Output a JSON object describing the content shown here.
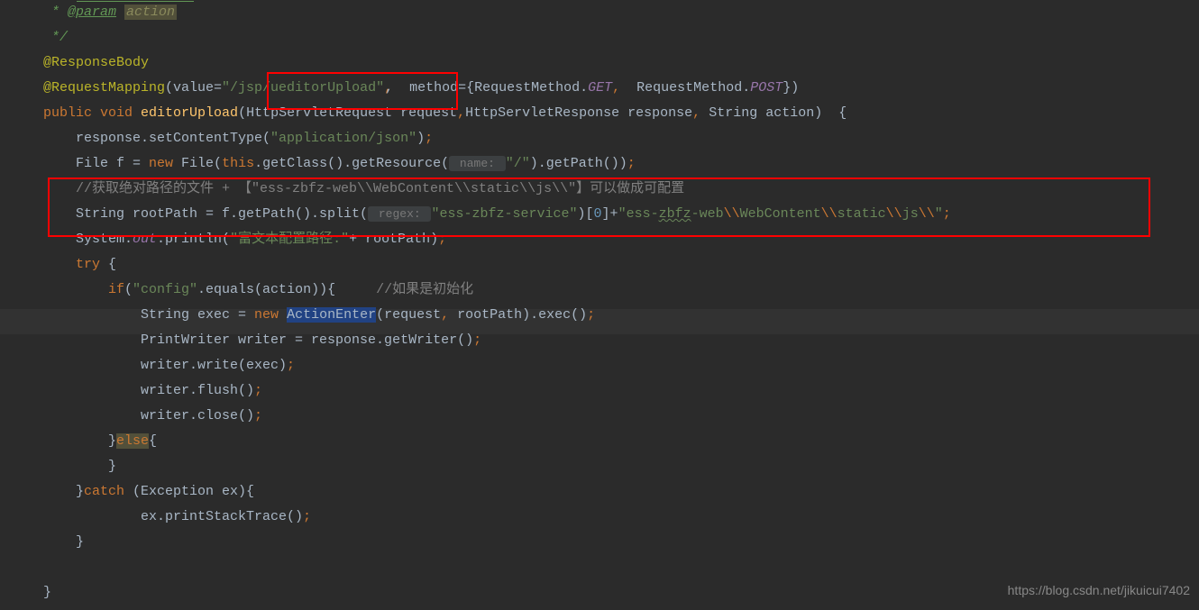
{
  "code": {
    "l1_star": " * ",
    "l1_param": "@param",
    "l1_space": " ",
    "l1_action": "action",
    "l2": " */",
    "l3": "@ResponseBody",
    "l4_anno": "@RequestMapping",
    "l4_open": "(value=",
    "l4_str": "\"/jsp/ueditorUpload\"",
    "l4_mid": ",  method={RequestMethod.",
    "l4_get": "GET",
    "l4_comma": ",",
    "l4_mid2": "  RequestMethod.",
    "l4_post": "POST",
    "l4_end": "})",
    "l5_public": "public",
    "l5_void": " void",
    "l5_method": " editorUpload",
    "l5_params": "(HttpServletRequest request",
    "l5_comma1": ",",
    "l5_params2": "HttpServletResponse response",
    "l5_comma2": ",",
    "l5_params3": " String action)  {",
    "l6_pre": "    response.setContentType(",
    "l6_str": "\"application/json\"",
    "l6_end": ")",
    "l6_semi": ";",
    "l7_pre": "    File f = ",
    "l7_new": "new",
    "l7_file": " File(",
    "l7_this": "this",
    "l7_mid": ".getClass().getResource(",
    "l7_hint": " name: ",
    "l7_str": "\"/\"",
    "l7_end": ").getPath())",
    "l7_semi": ";",
    "l8_comment": "    //获取绝对路径的文件 + 【\"ess-zbfz-web\\\\WebContent\\\\static\\\\js\\\\\"】可以做成可配置",
    "l9_pre": "    String rootPath = f.getPath().split(",
    "l9_hint": " regex: ",
    "l9_str1": "\"ess-zbfz-service\"",
    "l9_mid": ")[",
    "l9_num": "0",
    "l9_mid2": "]+",
    "l9_str2a": "\"ess-",
    "l9_str2b": "zbfz",
    "l9_str2c": "-web",
    "l9_esc1": "\\\\",
    "l9_wc": "WebContent",
    "l9_esc2": "\\\\",
    "l9_static": "static",
    "l9_esc3": "\\\\",
    "l9_js": "js",
    "l9_esc4": "\\\\",
    "l9_quote": "\"",
    "l9_semi": ";",
    "l10_pre": "    System.",
    "l10_out": "out",
    "l10_mid": ".println(",
    "l10_str": "\"富文本配置路径:\"",
    "l10_end": "+ rootPath)",
    "l10_semi": ";",
    "l11_try": "    try",
    "l11_brace": " {",
    "l12_if": "        if",
    "l12_open": "(",
    "l12_str": "\"config\"",
    "l12_mid": ".equals(action)){",
    "l12_comment": "     //如果是初始化",
    "l13_pre": "            String exec = ",
    "l13_new": "new",
    "l13_sp": " ",
    "l13_class": "ActionEnter",
    "l13_mid": "(request",
    "l13_comma": ",",
    "l13_end": " rootPath).exec()",
    "l13_semi": ";",
    "l14_pre": "            PrintWriter writer = response.getWriter()",
    "l14_semi": ";",
    "l15_pre": "            writer.write(exec)",
    "l15_semi": ";",
    "l16_pre": "            writer.flush()",
    "l16_semi": ";",
    "l17_pre": "            writer.close()",
    "l17_semi": ";",
    "l18_close": "        }",
    "l18_else": "else",
    "l18_brace": "{",
    "l19": "        }",
    "l20_close": "    }",
    "l20_catch": "catch",
    "l20_end": " (Exception ex){",
    "l21_pre": "            ex.printStackTrace()",
    "l21_semi": ";",
    "l22": "    }",
    "l23": "",
    "l24": "}"
  },
  "watermark": "https://blog.csdn.net/jikuicui7402"
}
